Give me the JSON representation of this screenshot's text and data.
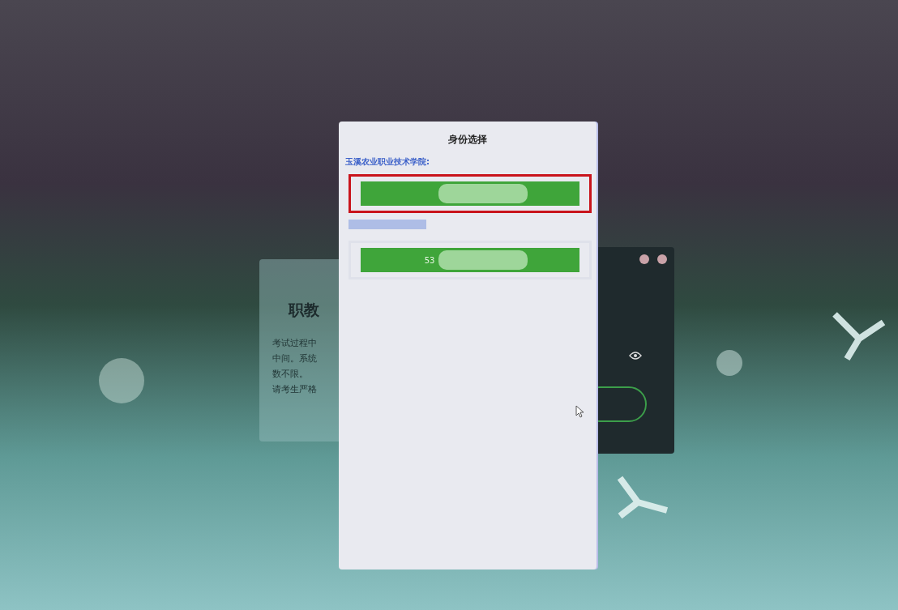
{
  "background_card": {
    "title": "职教",
    "lines": [
      "考试过程中",
      "中间。系统",
      "数不限。",
      "请考生严格"
    ]
  },
  "dialog": {
    "title": "身份选择",
    "groups": [
      {
        "kind": "named",
        "label": "玉溪农业职业技术学院:",
        "options": [
          {
            "highlighted": true
          }
        ]
      },
      {
        "kind": "redacted",
        "options": [
          {
            "label": "53",
            "highlighted": false
          }
        ]
      }
    ]
  }
}
